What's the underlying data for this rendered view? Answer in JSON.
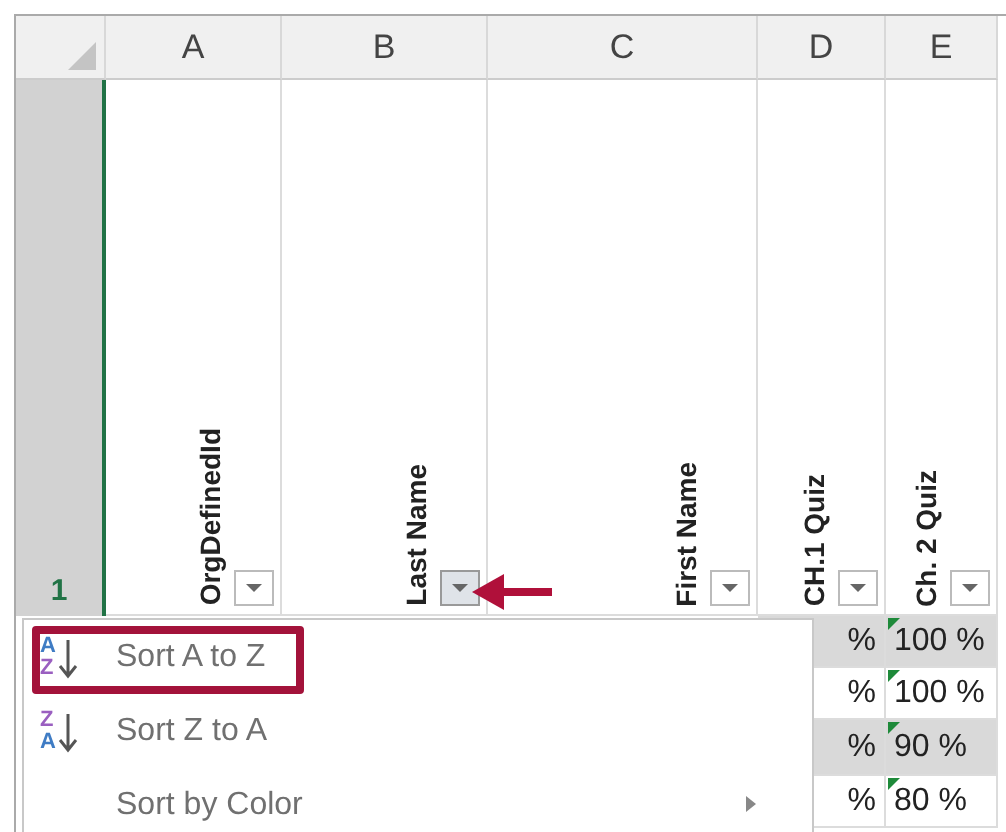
{
  "column_headers": [
    {
      "label": "A"
    },
    {
      "label": "B"
    },
    {
      "label": "C"
    },
    {
      "label": "D"
    },
    {
      "label": "E"
    }
  ],
  "row_header": {
    "label": "1",
    "selected": true
  },
  "header_cells": [
    {
      "text": "OrgDefinedId",
      "filter_active": false
    },
    {
      "text": "Last Name",
      "filter_active": true
    },
    {
      "text": "First Name",
      "filter_active": false
    },
    {
      "text": "CH.1 Quiz",
      "filter_active": false
    },
    {
      "text": "Ch. 2 Quiz",
      "filter_active": false
    }
  ],
  "data_rows": [
    {
      "shaded": true,
      "flagged": true,
      "cells": [
        "%",
        "100 %"
      ]
    },
    {
      "shaded": false,
      "flagged": true,
      "cells": [
        "%",
        "100 %"
      ]
    },
    {
      "shaded": true,
      "flagged": true,
      "cells": [
        "%",
        "90 %"
      ]
    },
    {
      "shaded": false,
      "flagged": true,
      "cells": [
        "%",
        "80 %"
      ]
    }
  ],
  "menu": {
    "items": [
      {
        "kind": "sort",
        "label": "Sort A to Z",
        "highlighted": true,
        "icon": [
          {
            "letter": "A",
            "color": "#3f7cc4"
          },
          {
            "letter": "Z",
            "color": "#9a5fc0"
          }
        ]
      },
      {
        "kind": "sort",
        "label": "Sort Z to A",
        "highlighted": false,
        "icon": [
          {
            "letter": "Z",
            "color": "#9a5fc0"
          },
          {
            "letter": "A",
            "color": "#3f7cc4"
          }
        ]
      },
      {
        "kind": "submenu",
        "label": "Sort by Color",
        "highlighted": false
      }
    ]
  }
}
